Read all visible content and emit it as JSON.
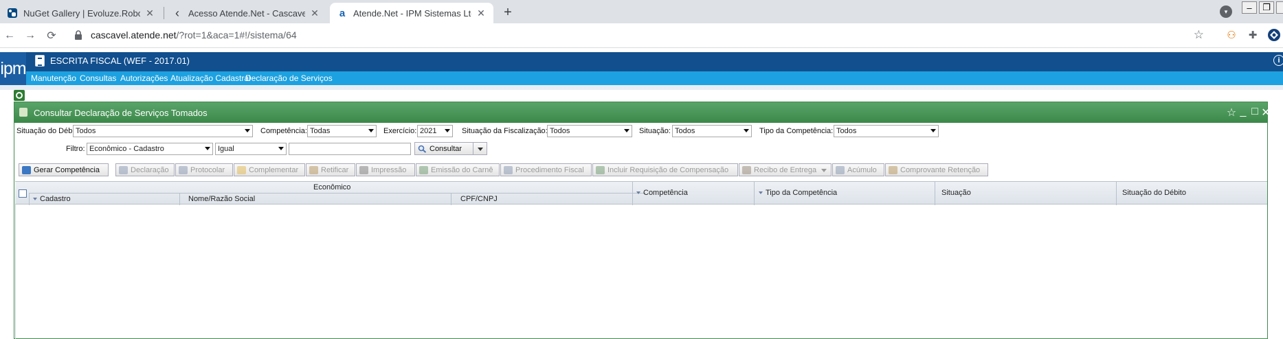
{
  "browser": {
    "tabs": [
      {
        "title": "NuGet Gallery | Evoluze.Roboluze",
        "icon": "nuget-icon",
        "active": false
      },
      {
        "title": "Acesso Atende.Net - Cascavel/PR",
        "icon": "back-arrow-icon",
        "active": false
      },
      {
        "title": "Atende.Net - IPM Sistemas Ltda.",
        "icon": "atende-icon",
        "active": true
      }
    ],
    "url_host": "cascavel.atende.net",
    "url_path": "/?rot=1&aca=1#!/sistema/64"
  },
  "app": {
    "logo": "ipm",
    "title": "ESCRITA FISCAL (WEF - 2017.01)",
    "menu": [
      "Manutenção",
      "Consultas",
      "Autorizações",
      "Atualização Cadastral",
      "Declaração de Serviços"
    ]
  },
  "window": {
    "title": "Consultar Declaração de Serviços Tomados"
  },
  "filters": {
    "situacao_debito_label": "Situação do Débito:",
    "situacao_debito_value": "Todos",
    "competencia_label": "Competência:",
    "competencia_value": "Todas",
    "exercicio_label": "Exercício:",
    "exercicio_value": "2021",
    "situacao_fiscalizacao_label": "Situação da Fiscalização:",
    "situacao_fiscalizacao_value": "Todos",
    "situacao_label": "Situação:",
    "situacao_value": "Todos",
    "tipo_competencia_label": "Tipo da Competência:",
    "tipo_competencia_value": "Todos",
    "filtro_label": "Filtro:",
    "filtro_field_value": "Econômico - Cadastro",
    "filtro_operator_value": "Igual",
    "filtro_text_value": "",
    "consultar_label": "Consultar"
  },
  "actions": [
    {
      "label": "Gerar Competência",
      "enabled": true,
      "icon": "generate-icon",
      "color": "#3c78c3"
    },
    {
      "label": "Declaração",
      "enabled": false,
      "icon": "declaration-icon",
      "color": "#7a8aa8"
    },
    {
      "label": "Protocolar",
      "enabled": false,
      "icon": "protocol-icon",
      "color": "#7a8aa8"
    },
    {
      "label": "Complementar",
      "enabled": false,
      "icon": "folder-icon",
      "color": "#e0b13c"
    },
    {
      "label": "Retificar",
      "enabled": false,
      "icon": "edit-icon",
      "color": "#b08a4a"
    },
    {
      "label": "Impressão",
      "enabled": false,
      "icon": "printer-icon",
      "color": "#6d6d6d"
    },
    {
      "label": "Emissão do Carnê",
      "enabled": false,
      "icon": "invoice-icon",
      "color": "#5f8d5f"
    },
    {
      "label": "Procedimento Fiscal",
      "enabled": false,
      "icon": "search-doc-icon",
      "color": "#7a8aa8"
    },
    {
      "label": "Incluir Requisição de Compensação",
      "enabled": false,
      "icon": "add-doc-icon",
      "color": "#5f8d5f"
    },
    {
      "label": "Recibo de Entrega",
      "enabled": false,
      "icon": "receipt-icon",
      "color": "#8a7a6a"
    },
    {
      "label": "Acúmulo",
      "enabled": false,
      "icon": "stack-icon",
      "color": "#7a8aa8"
    },
    {
      "label": "Comprovante Retenção",
      "enabled": false,
      "icon": "certificate-icon",
      "color": "#b08a4a"
    }
  ],
  "grid": {
    "group_header": "Econômico",
    "columns": [
      "Cadastro",
      "Nome/Razão Social",
      "CPF/CNPJ",
      "Competência",
      "Tipo da Competência",
      "Situação",
      "Situação do Débito"
    ]
  }
}
